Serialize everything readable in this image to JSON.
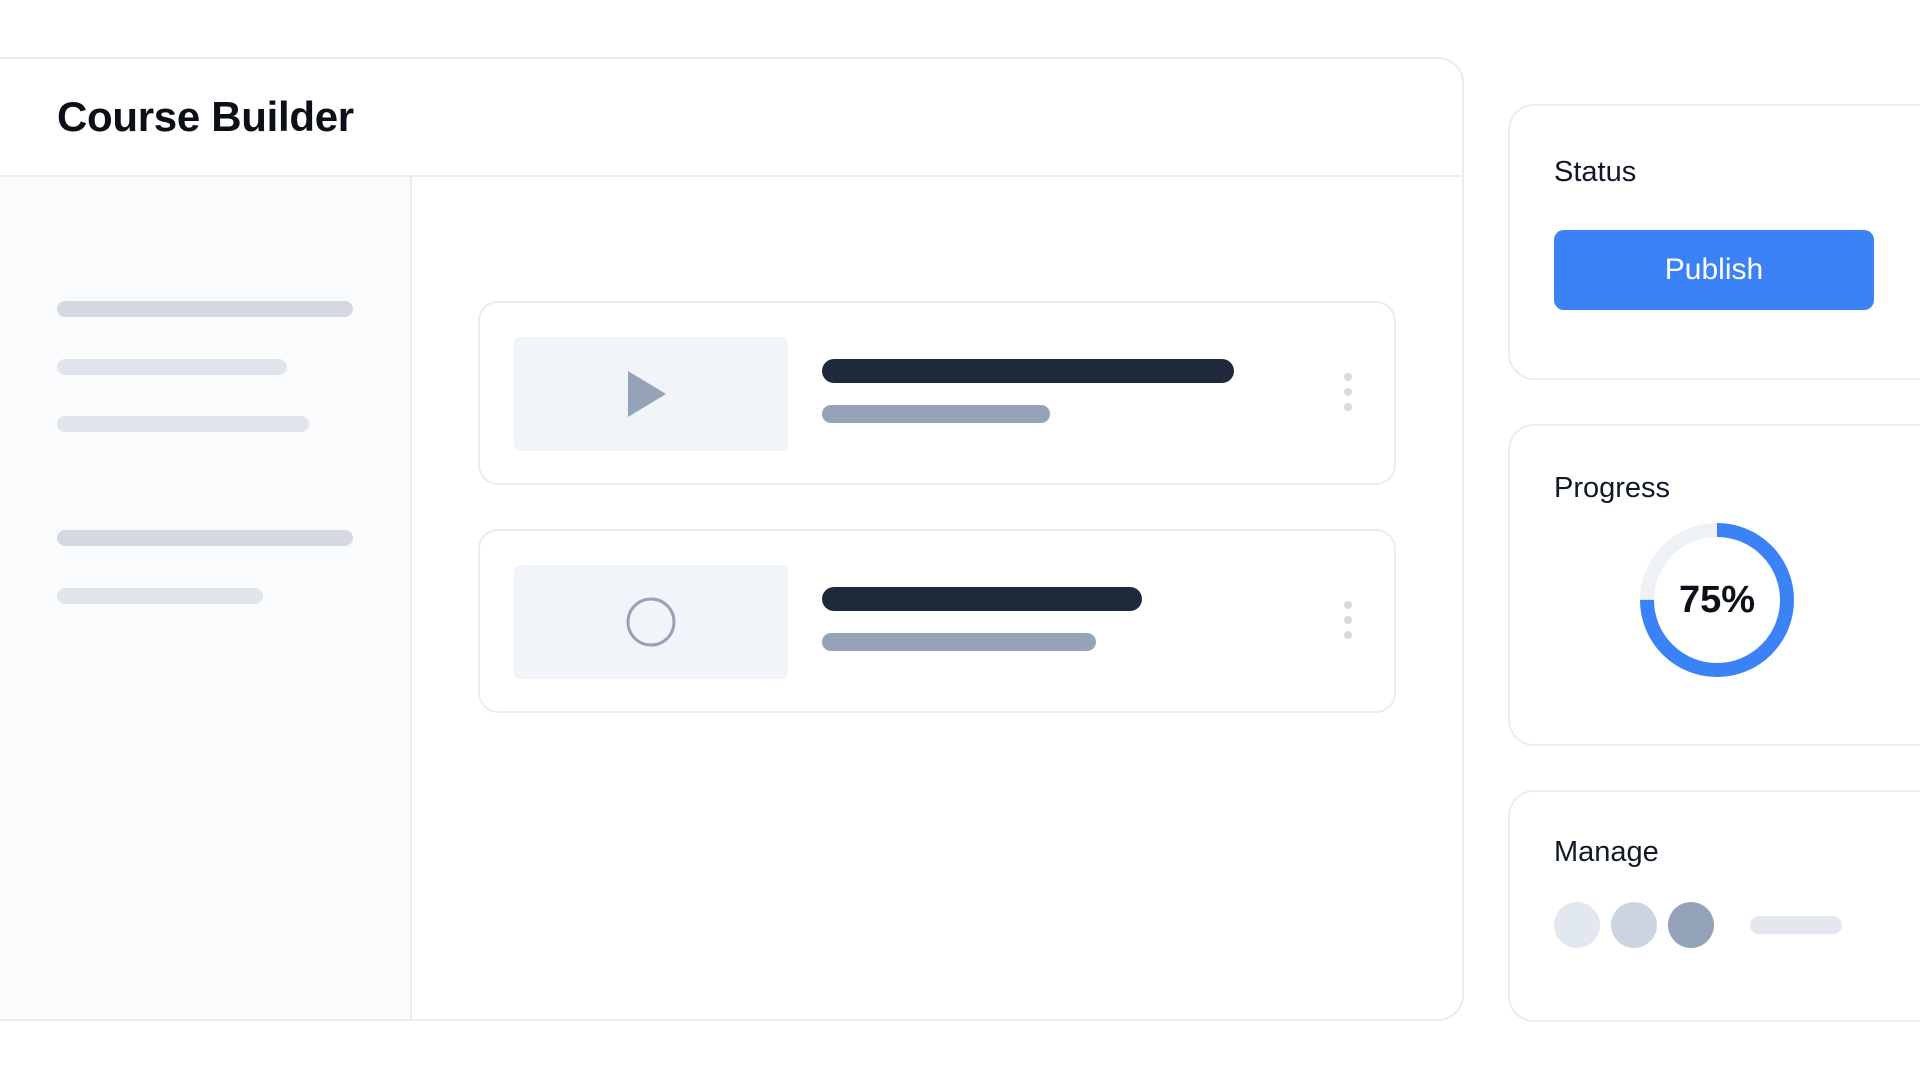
{
  "header": {
    "title": "Course Builder"
  },
  "lessons": [
    {
      "thumbnail_icon": "play-icon"
    },
    {
      "thumbnail_icon": "circle-icon"
    }
  ],
  "status_card": {
    "title": "Status",
    "publish_label": "Publish"
  },
  "progress_card": {
    "title": "Progress",
    "percent": 75,
    "percent_label": "75%"
  },
  "manage_card": {
    "title": "Manage",
    "avatar_count": 3
  },
  "colors": {
    "accent": "#3b82f6",
    "ring_track": "#eef1f5",
    "dark_text_line": "#1e293b",
    "muted_line": "#94a3b8",
    "avatar_1": "#e2e8f0",
    "avatar_2": "#cbd5e1",
    "avatar_3": "#94a3b8"
  }
}
